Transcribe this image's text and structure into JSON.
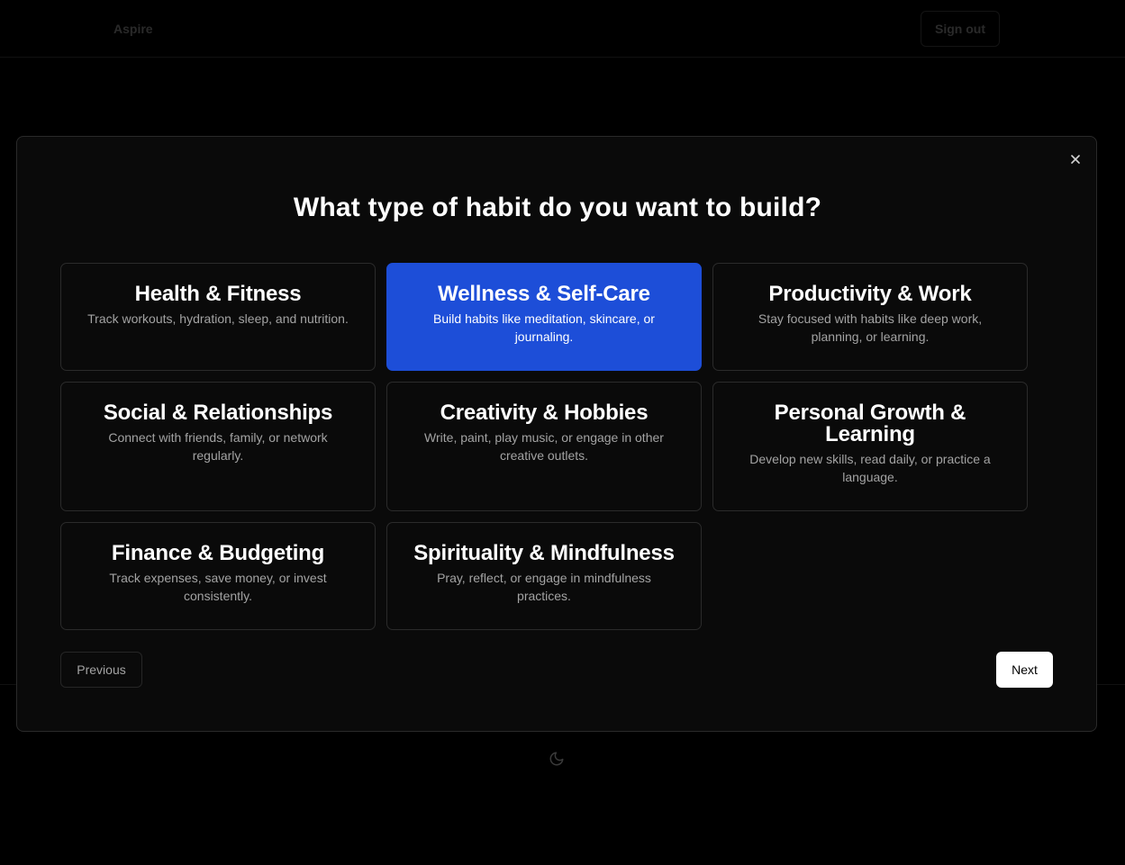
{
  "app": {
    "brand": "Aspire",
    "signout_label": "Sign out"
  },
  "modal": {
    "title": "What type of habit do you want to build?",
    "close_icon": "close-icon",
    "categories": [
      {
        "title": "Health & Fitness",
        "description": "Track workouts, hydration, sleep, and nutrition.",
        "selected": false
      },
      {
        "title": "Wellness & Self-Care",
        "description": "Build habits like meditation, skincare, or journaling.",
        "selected": true
      },
      {
        "title": "Productivity & Work",
        "description": "Stay focused with habits like deep work, planning, or learning.",
        "selected": false
      },
      {
        "title": "Social & Relationships",
        "description": "Connect with friends, family, or network regularly.",
        "selected": false
      },
      {
        "title": "Creativity & Hobbies",
        "description": "Write, paint, play music, or engage in other creative outlets.",
        "selected": false
      },
      {
        "title": "Personal Growth & Learning",
        "description": "Develop new skills, read daily, or practice a language.",
        "selected": false
      },
      {
        "title": "Finance & Budgeting",
        "description": "Track expenses, save money, or invest consistently.",
        "selected": false
      },
      {
        "title": "Spirituality & Mindfulness",
        "description": "Pray, reflect, or engage in mindfulness practices.",
        "selected": false
      }
    ],
    "previous_label": "Previous",
    "next_label": "Next"
  },
  "footer": {
    "theme_toggle_icon": "moon-icon"
  },
  "colors": {
    "accent": "#1d4ed8",
    "background": "#000000",
    "modal_bg": "#0a0a0a"
  }
}
